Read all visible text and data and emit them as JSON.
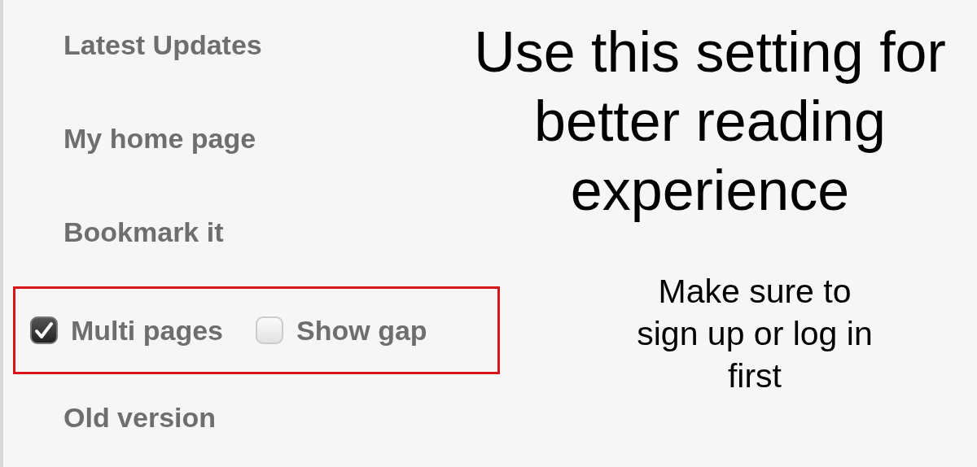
{
  "menu": [
    {
      "kind": "link",
      "label": "Latest Updates"
    },
    {
      "kind": "link",
      "label": "My home page"
    },
    {
      "kind": "link",
      "label": "Bookmark it"
    },
    {
      "kind": "options",
      "highlighted": true,
      "options": [
        {
          "label": "Multi pages",
          "checked": true
        },
        {
          "label": "Show gap",
          "checked": false
        }
      ]
    },
    {
      "kind": "link",
      "label": "Old version"
    }
  ],
  "headline": "Use this setting for better reading experience",
  "note": "Make sure to sign up or log in first"
}
